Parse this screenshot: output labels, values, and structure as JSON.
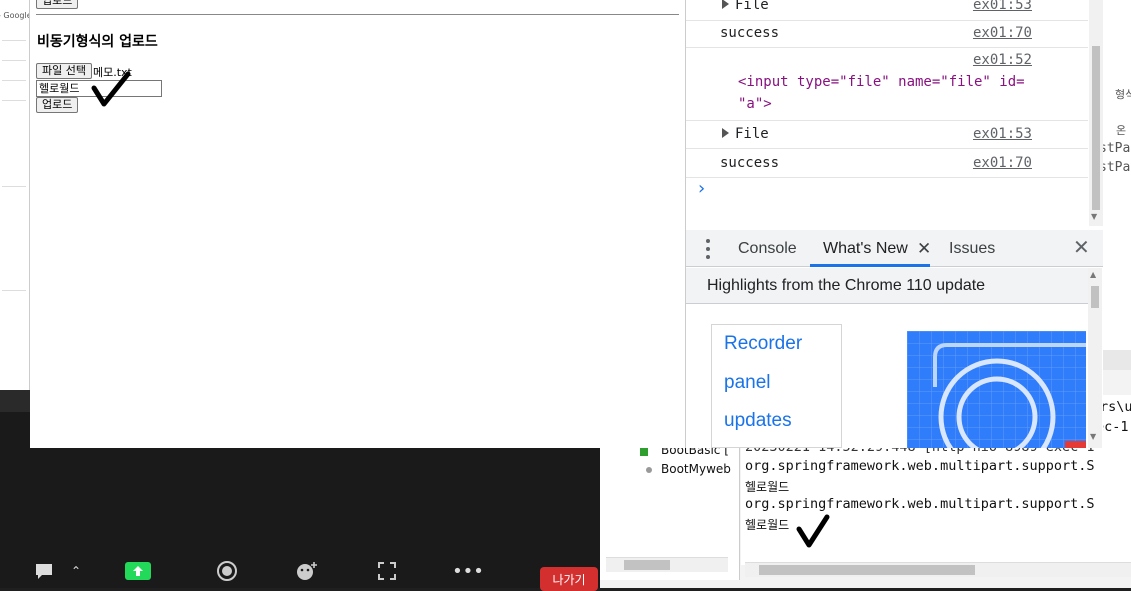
{
  "bg_left": {
    "google_text": "- Google 검"
  },
  "page": {
    "top_upload_label": "업로드",
    "heading": "비동기형식의 업로드",
    "file_button_label": "파일 선택",
    "file_name": "메모.txt",
    "text_value": "헬로월드",
    "upload_label": "업로드"
  },
  "console": {
    "rows": [
      {
        "text": "File",
        "source": "ex01:53",
        "expandable": true
      },
      {
        "text": "success",
        "source": "ex01:70"
      },
      {
        "html_lines": [
          "<input type=\"file\" name=\"file\" id=",
          "\"a\">"
        ],
        "source": "ex01:52"
      },
      {
        "text": "File",
        "source": "ex01:53",
        "expandable": true
      },
      {
        "text": "success",
        "source": "ex01:70"
      }
    ],
    "prompt": "›"
  },
  "drawer": {
    "tabs": [
      "Console",
      "What's New",
      "Issues"
    ],
    "active_tab": "What's New",
    "highlights_title": "Highlights from the Chrome 110 update",
    "card_lines": [
      "Recorder",
      "panel",
      "updates"
    ]
  },
  "bg_right": {
    "lines": [
      "형식",
      "온",
      "stPa",
      "stPa"
    ]
  },
  "eclipse": {
    "tree_items": [
      "BootBasic [",
      "BootMyweb"
    ],
    "console_lines": [
      "rs\\u",
      "ec-1",
      "20230221 14:52:29.448 [http-nio-8989-exec-1",
      "org.springframework.web.multipart.support.S",
      "헬로월드",
      "org.springframework.web.multipart.support.S",
      "헬로월드"
    ]
  },
  "zoom": {
    "leave_label": "나가기"
  },
  "colors": {
    "accent": "#1a73e8",
    "zoom_green": "#23d959",
    "leave_red": "#d32f2f"
  }
}
